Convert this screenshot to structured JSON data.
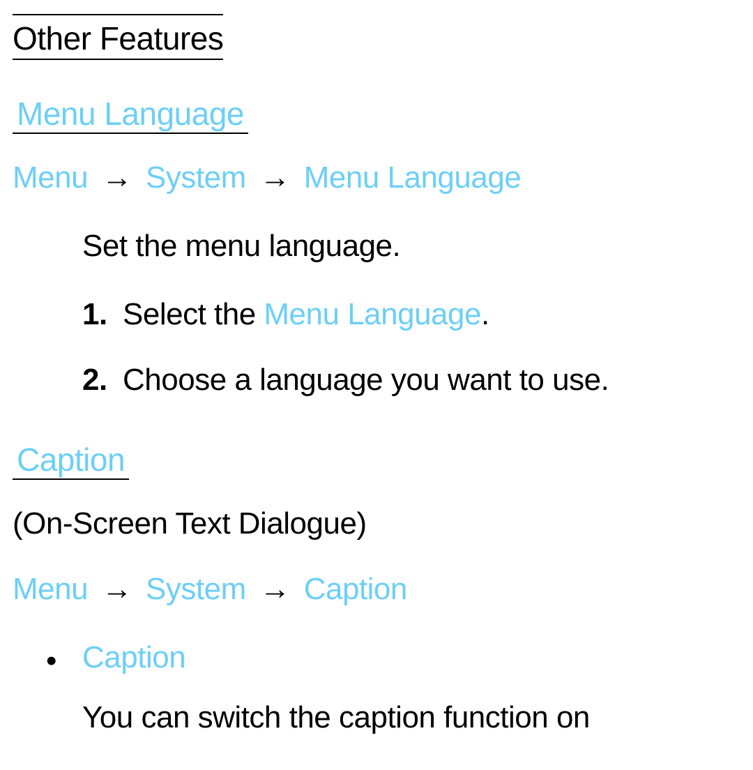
{
  "page_title": "Other Features",
  "section1": {
    "heading": "Menu Language",
    "breadcrumb": {
      "item1": "Menu",
      "item2": "System",
      "item3": "Menu Language"
    },
    "description": "Set the menu language.",
    "steps": {
      "step1_prefix": "Select the ",
      "step1_link": "Menu Language",
      "step1_suffix": ".",
      "step2": "Choose a language you want to use."
    }
  },
  "section2": {
    "heading": "Caption",
    "subtitle": "(On-Screen Text Dialogue)",
    "breadcrumb": {
      "item1": "Menu",
      "item2": "System",
      "item3": "Caption"
    },
    "bullet1": {
      "title": "Caption",
      "desc": "You can switch the caption function on"
    }
  },
  "arrow": "→"
}
